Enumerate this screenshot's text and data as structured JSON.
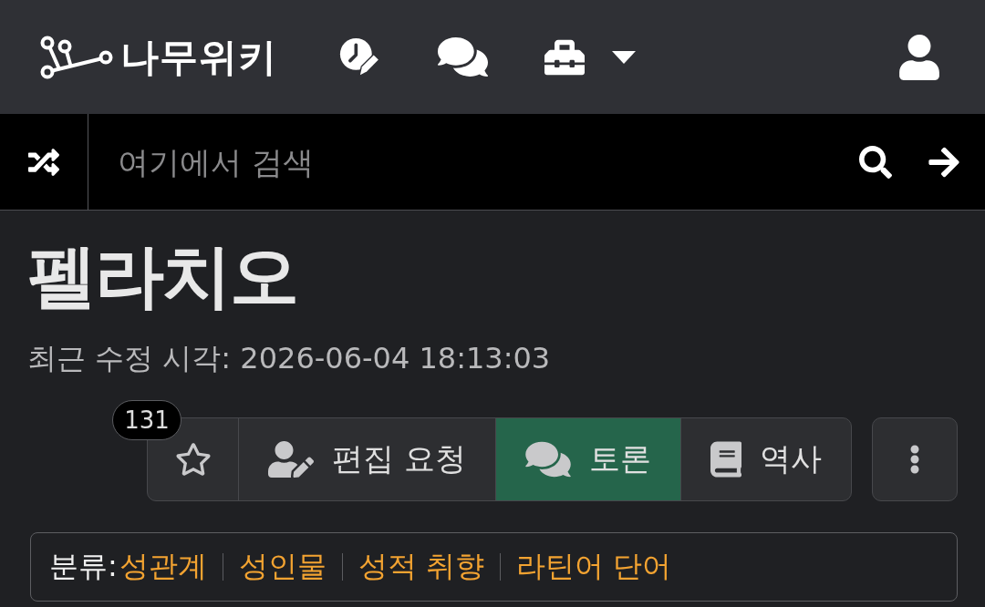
{
  "header": {
    "logo_text": "나무위키"
  },
  "search": {
    "placeholder": "여기에서 검색"
  },
  "article": {
    "title": "펠라치오",
    "last_modified": "최근 수정 시각: 2026-06-04 18:13:03"
  },
  "toolbar": {
    "star_count": "131",
    "starred": false,
    "buttons": [
      {
        "kind": "edit_request",
        "label": "편집 요청",
        "selected": false
      },
      {
        "kind": "discussion",
        "label": "토론",
        "selected": true
      },
      {
        "kind": "history",
        "label": "역사",
        "selected": false
      }
    ]
  },
  "categories": {
    "label": "분류:",
    "items": [
      "성관계",
      "성인물",
      "성적 취향",
      "라틴어 단어"
    ]
  }
}
